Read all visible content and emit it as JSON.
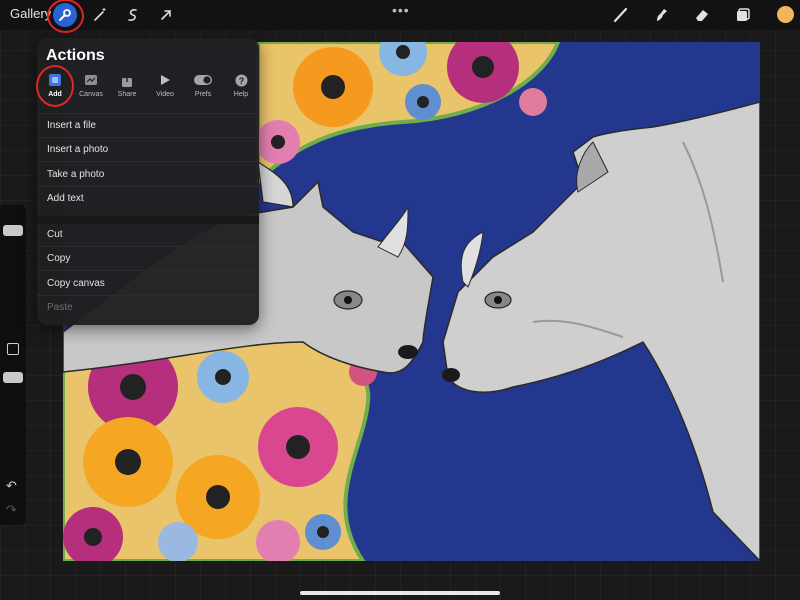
{
  "topbar": {
    "gallery_label": "Gallery",
    "left_tools": [
      "wrench-icon",
      "magic-wand-icon",
      "selection-icon",
      "transform-icon"
    ],
    "right_tools": [
      "brush-icon",
      "smudge-icon",
      "eraser-icon",
      "layers-icon"
    ],
    "current_color": "#f3b45a",
    "more": "•••"
  },
  "actions_panel": {
    "title": "Actions",
    "tabs": [
      {
        "label": "Add",
        "icon": "add-icon",
        "active": true
      },
      {
        "label": "Canvas",
        "icon": "canvas-icon",
        "active": false
      },
      {
        "label": "Share",
        "icon": "share-icon",
        "active": false
      },
      {
        "label": "Video",
        "icon": "video-icon",
        "active": false
      },
      {
        "label": "Prefs",
        "icon": "toggle-icon",
        "active": false
      },
      {
        "label": "Help",
        "icon": "help-icon",
        "active": false
      }
    ],
    "menu_group_1": [
      "Insert a file",
      "Insert a photo",
      "Take a photo",
      "Add text"
    ],
    "menu_group_2": [
      "Cut",
      "Copy",
      "Copy canvas"
    ],
    "disabled_item": "Paste"
  },
  "sidebar": {
    "undo": "↶",
    "redo": "↷"
  },
  "canvas": {
    "background_color": "#23378f",
    "artwork": "rhino-illustration"
  }
}
